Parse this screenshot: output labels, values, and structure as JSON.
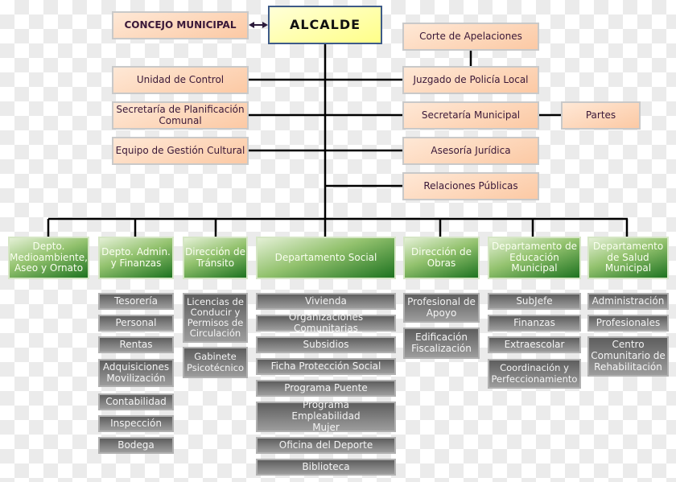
{
  "top": {
    "council": "CONCEJO MUNICIPAL",
    "mayor": "ALCALDE"
  },
  "left_staff": [
    "Unidad de Control",
    "Secretaría de Planificación Comunal",
    "Equipo de Gestión Cultural"
  ],
  "right_staff": {
    "court": "Corte de Apelaciones",
    "police_court": "Juzgado de Policía Local",
    "secretary": "Secretaría Municipal",
    "parts": "Partes",
    "legal": "Asesoría Jurídica",
    "pr": "Relaciones Públicas"
  },
  "departments": [
    {
      "name": "Depto. Medioambiente, Aseo y Ornato",
      "units": []
    },
    {
      "name": "Depto. Admin. y Finanzas",
      "units": [
        "Tesorería",
        "Personal",
        "Rentas",
        "Adquisiciones Movilización",
        "Contabilidad",
        "Inspección",
        "Bodega"
      ]
    },
    {
      "name": "Dirección de Tránsito",
      "units": [
        "Licencias de Conducir y Permisos de Circulación",
        "Gabinete Psicotécnico"
      ]
    },
    {
      "name": "Departamento Social",
      "units": [
        "Vivienda",
        "Organizaciones Comunitarias",
        "Subsidios",
        "Ficha Protección Social",
        "Programa Puente",
        "Programa Empleabilidad Mujer",
        "Oficina del Deporte",
        "Biblioteca"
      ]
    },
    {
      "name": "Dirección de Obras",
      "units": [
        "Profesional de Apoyo",
        "Edificación Fiscalización"
      ]
    },
    {
      "name": "Departamento de Educación Municipal",
      "units": [
        "SubJefe",
        "Finanzas",
        "Extraescolar",
        "Coordinación y Perfeccionamiento"
      ]
    },
    {
      "name": "Departamento de Salud Municipal",
      "units": [
        "Administración",
        "Profesionales",
        "Centro Comunitario de Rehabilitación"
      ]
    }
  ],
  "colors": {
    "staff_box": "#fcc9a4",
    "mayor_box": "#ffff88",
    "department_box": "#1e7320",
    "unit_box": "#7a7a7a"
  }
}
